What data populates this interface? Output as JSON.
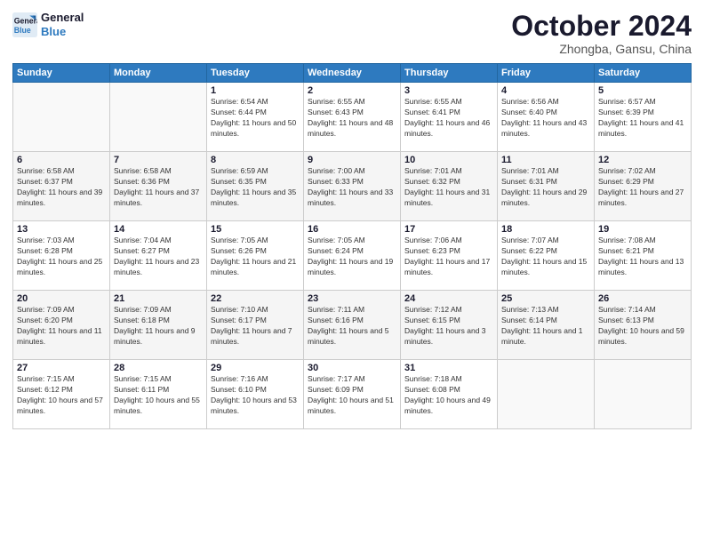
{
  "header": {
    "logo_line1": "General",
    "logo_line2": "Blue",
    "month": "October 2024",
    "location": "Zhongba, Gansu, China"
  },
  "weekdays": [
    "Sunday",
    "Monday",
    "Tuesday",
    "Wednesday",
    "Thursday",
    "Friday",
    "Saturday"
  ],
  "weeks": [
    [
      {
        "day": "",
        "info": ""
      },
      {
        "day": "",
        "info": ""
      },
      {
        "day": "1",
        "info": "Sunrise: 6:54 AM\nSunset: 6:44 PM\nDaylight: 11 hours and 50 minutes."
      },
      {
        "day": "2",
        "info": "Sunrise: 6:55 AM\nSunset: 6:43 PM\nDaylight: 11 hours and 48 minutes."
      },
      {
        "day": "3",
        "info": "Sunrise: 6:55 AM\nSunset: 6:41 PM\nDaylight: 11 hours and 46 minutes."
      },
      {
        "day": "4",
        "info": "Sunrise: 6:56 AM\nSunset: 6:40 PM\nDaylight: 11 hours and 43 minutes."
      },
      {
        "day": "5",
        "info": "Sunrise: 6:57 AM\nSunset: 6:39 PM\nDaylight: 11 hours and 41 minutes."
      }
    ],
    [
      {
        "day": "6",
        "info": "Sunrise: 6:58 AM\nSunset: 6:37 PM\nDaylight: 11 hours and 39 minutes."
      },
      {
        "day": "7",
        "info": "Sunrise: 6:58 AM\nSunset: 6:36 PM\nDaylight: 11 hours and 37 minutes."
      },
      {
        "day": "8",
        "info": "Sunrise: 6:59 AM\nSunset: 6:35 PM\nDaylight: 11 hours and 35 minutes."
      },
      {
        "day": "9",
        "info": "Sunrise: 7:00 AM\nSunset: 6:33 PM\nDaylight: 11 hours and 33 minutes."
      },
      {
        "day": "10",
        "info": "Sunrise: 7:01 AM\nSunset: 6:32 PM\nDaylight: 11 hours and 31 minutes."
      },
      {
        "day": "11",
        "info": "Sunrise: 7:01 AM\nSunset: 6:31 PM\nDaylight: 11 hours and 29 minutes."
      },
      {
        "day": "12",
        "info": "Sunrise: 7:02 AM\nSunset: 6:29 PM\nDaylight: 11 hours and 27 minutes."
      }
    ],
    [
      {
        "day": "13",
        "info": "Sunrise: 7:03 AM\nSunset: 6:28 PM\nDaylight: 11 hours and 25 minutes."
      },
      {
        "day": "14",
        "info": "Sunrise: 7:04 AM\nSunset: 6:27 PM\nDaylight: 11 hours and 23 minutes."
      },
      {
        "day": "15",
        "info": "Sunrise: 7:05 AM\nSunset: 6:26 PM\nDaylight: 11 hours and 21 minutes."
      },
      {
        "day": "16",
        "info": "Sunrise: 7:05 AM\nSunset: 6:24 PM\nDaylight: 11 hours and 19 minutes."
      },
      {
        "day": "17",
        "info": "Sunrise: 7:06 AM\nSunset: 6:23 PM\nDaylight: 11 hours and 17 minutes."
      },
      {
        "day": "18",
        "info": "Sunrise: 7:07 AM\nSunset: 6:22 PM\nDaylight: 11 hours and 15 minutes."
      },
      {
        "day": "19",
        "info": "Sunrise: 7:08 AM\nSunset: 6:21 PM\nDaylight: 11 hours and 13 minutes."
      }
    ],
    [
      {
        "day": "20",
        "info": "Sunrise: 7:09 AM\nSunset: 6:20 PM\nDaylight: 11 hours and 11 minutes."
      },
      {
        "day": "21",
        "info": "Sunrise: 7:09 AM\nSunset: 6:18 PM\nDaylight: 11 hours and 9 minutes."
      },
      {
        "day": "22",
        "info": "Sunrise: 7:10 AM\nSunset: 6:17 PM\nDaylight: 11 hours and 7 minutes."
      },
      {
        "day": "23",
        "info": "Sunrise: 7:11 AM\nSunset: 6:16 PM\nDaylight: 11 hours and 5 minutes."
      },
      {
        "day": "24",
        "info": "Sunrise: 7:12 AM\nSunset: 6:15 PM\nDaylight: 11 hours and 3 minutes."
      },
      {
        "day": "25",
        "info": "Sunrise: 7:13 AM\nSunset: 6:14 PM\nDaylight: 11 hours and 1 minute."
      },
      {
        "day": "26",
        "info": "Sunrise: 7:14 AM\nSunset: 6:13 PM\nDaylight: 10 hours and 59 minutes."
      }
    ],
    [
      {
        "day": "27",
        "info": "Sunrise: 7:15 AM\nSunset: 6:12 PM\nDaylight: 10 hours and 57 minutes."
      },
      {
        "day": "28",
        "info": "Sunrise: 7:15 AM\nSunset: 6:11 PM\nDaylight: 10 hours and 55 minutes."
      },
      {
        "day": "29",
        "info": "Sunrise: 7:16 AM\nSunset: 6:10 PM\nDaylight: 10 hours and 53 minutes."
      },
      {
        "day": "30",
        "info": "Sunrise: 7:17 AM\nSunset: 6:09 PM\nDaylight: 10 hours and 51 minutes."
      },
      {
        "day": "31",
        "info": "Sunrise: 7:18 AM\nSunset: 6:08 PM\nDaylight: 10 hours and 49 minutes."
      },
      {
        "day": "",
        "info": ""
      },
      {
        "day": "",
        "info": ""
      }
    ]
  ]
}
